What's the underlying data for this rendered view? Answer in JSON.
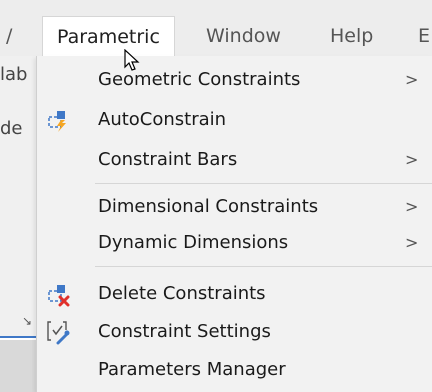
{
  "menubar": {
    "fragment_left": "/",
    "items": [
      {
        "label": "Parametric",
        "active": true
      },
      {
        "label": "Window"
      },
      {
        "label": "Help"
      },
      {
        "label": "E"
      }
    ]
  },
  "background_app": {
    "fragments": [
      "lab",
      "de"
    ]
  },
  "dropdown": {
    "items": [
      {
        "label": "Geometric Constraints",
        "has_submenu": true,
        "chevron": ">"
      },
      {
        "label": "AutoConstrain",
        "icon": "autoconstrain-icon"
      },
      {
        "label": "Constraint Bars",
        "has_submenu": true,
        "chevron": ">"
      },
      {
        "label": "Dimensional Constraints",
        "has_submenu": true,
        "chevron": ">"
      },
      {
        "label": "Dynamic Dimensions",
        "has_submenu": true,
        "chevron": ">"
      },
      {
        "label": "Delete Constraints",
        "icon": "delete-constraints-icon"
      },
      {
        "label": "Constraint Settings",
        "icon": "constraint-settings-icon"
      },
      {
        "label": "Parameters Manager"
      }
    ]
  },
  "colors": {
    "menubar_bg": "#ededed",
    "dropdown_bg": "#f2f2f2",
    "accent_blue": "#3f78c7",
    "accent_orange": "#f5a623",
    "accent_red": "#e0302b"
  }
}
